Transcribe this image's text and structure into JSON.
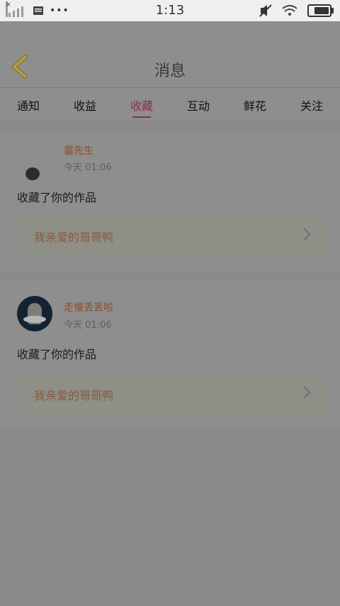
{
  "status_bar": {
    "time": "1:13"
  },
  "header": {
    "title": "消息"
  },
  "tabs": [
    {
      "label": "通知"
    },
    {
      "label": "收益"
    },
    {
      "label": "收藏"
    },
    {
      "label": "互动"
    },
    {
      "label": "鲜花"
    },
    {
      "label": "关注"
    }
  ],
  "active_tab": "收藏",
  "notifications": [
    {
      "username": "霎先生",
      "time": "今天 01:06",
      "action": "收藏了你的作品",
      "work_title": "我亲爱的哥哥鸭"
    },
    {
      "username": "走慢丢丢啦",
      "time": "今天 01:06",
      "action": "收藏了你的作品",
      "work_title": "我亲爱的哥哥鸭"
    }
  ],
  "colors": {
    "accent": "#8a2e45",
    "username": "#8f4b2a",
    "work_title": "#8a5a3c"
  }
}
